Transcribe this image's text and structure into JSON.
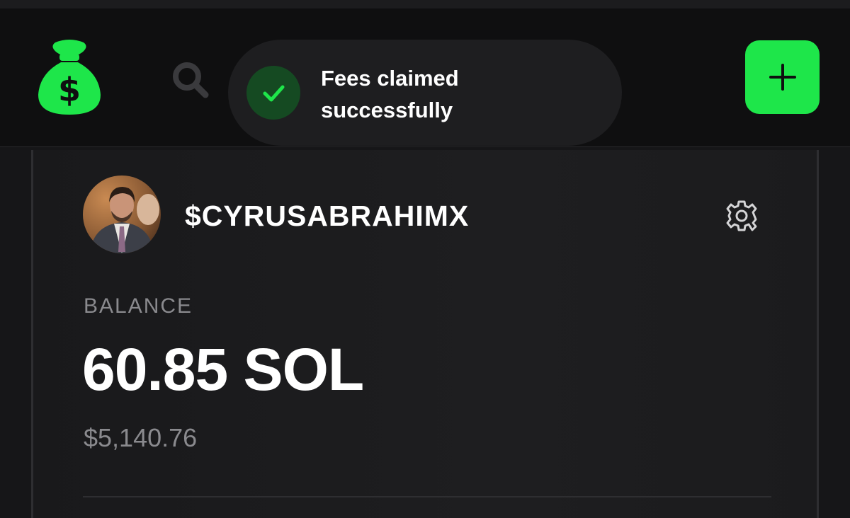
{
  "header": {
    "logo_icon": "money-bag-icon",
    "search_icon": "search-icon",
    "add_icon": "plus-icon",
    "accent_color": "#1ee64a"
  },
  "toast": {
    "icon": "check-icon",
    "line1": "Fees claimed",
    "line2": "successfully"
  },
  "profile": {
    "username": "$CYRUSABRAHIMX",
    "settings_icon": "gear-icon"
  },
  "balance": {
    "label": "BALANCE",
    "value": "60.85 SOL",
    "usd": "$5,140.76"
  }
}
